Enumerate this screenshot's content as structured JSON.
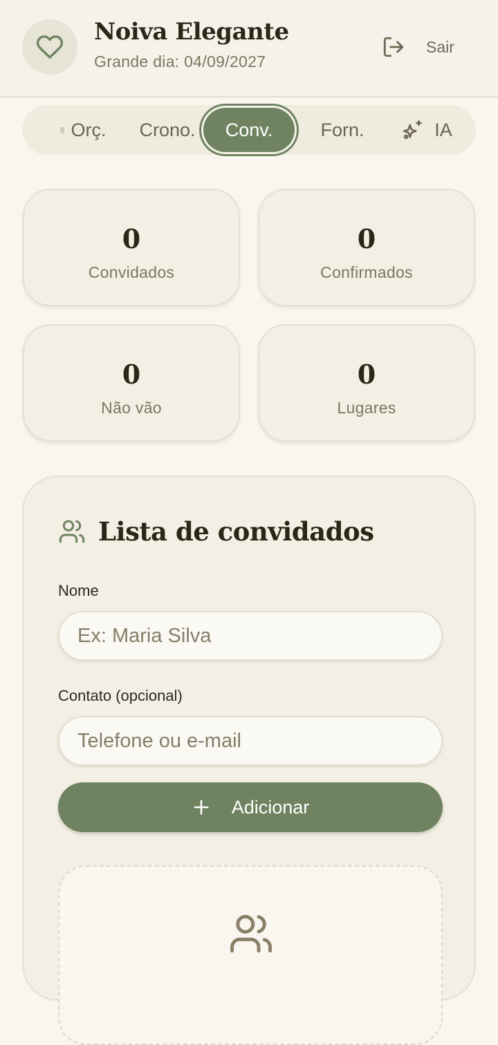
{
  "header": {
    "title": "Noiva Elegante",
    "subtitle": "Grande dia: 04/09/2027",
    "logout_label": "Sair",
    "logo_icon": "heart-icon",
    "logout_icon": "logout-icon"
  },
  "tabs": [
    {
      "label": "Orç.",
      "active": false
    },
    {
      "label": "Crono.",
      "active": false
    },
    {
      "label": "Conv.",
      "active": true
    },
    {
      "label": "Forn.",
      "active": false
    },
    {
      "label": "IA",
      "active": false,
      "icon": "sparkles-icon"
    }
  ],
  "stats": [
    {
      "value": "0",
      "label": "Convidados"
    },
    {
      "value": "0",
      "label": "Confirmados"
    },
    {
      "value": "0",
      "label": "Não vão"
    },
    {
      "value": "0",
      "label": "Lugares"
    }
  ],
  "guest_list": {
    "title": "Lista de convidados",
    "title_icon": "users-icon",
    "name_label": "Nome",
    "name_placeholder": "Ex: Maria Silva",
    "contact_label": "Contato (opcional)",
    "contact_placeholder": "Telefone ou e-mail",
    "add_label": "Adicionar",
    "empty_icon": "users-icon"
  },
  "colors": {
    "accent": "#6f8360",
    "background": "#f9f6ef",
    "card": "#f3efe5",
    "text": "#2a2718",
    "muted": "#7c7560"
  }
}
